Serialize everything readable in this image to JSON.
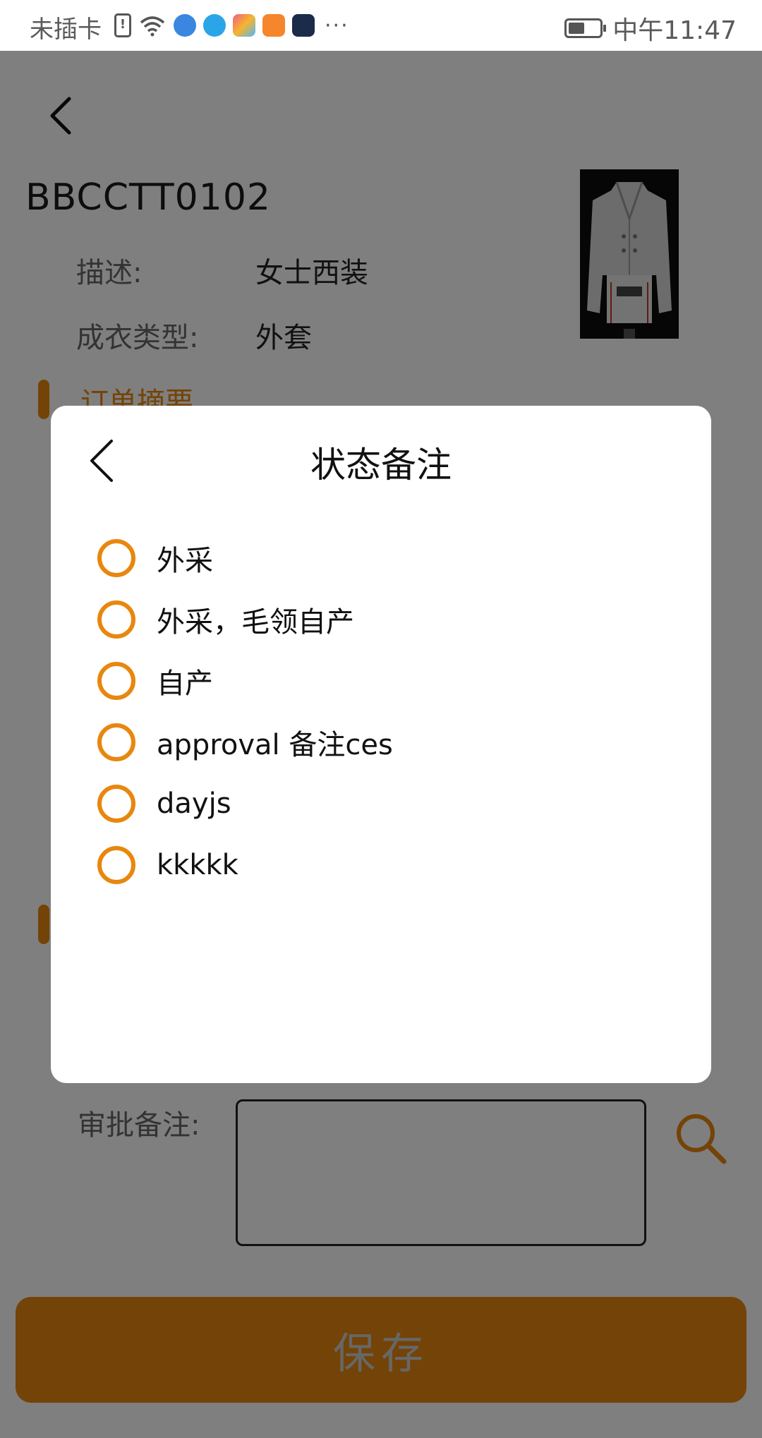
{
  "status_bar": {
    "carrier": "未插卡",
    "sim_icon": "!",
    "more": "···",
    "time": "中午11:47"
  },
  "page": {
    "order_code": "BBCCTT0102",
    "description_label": "描述:",
    "description_value": "女士西装",
    "garment_type_label": "成衣类型:",
    "garment_type_value": "外套",
    "section_title": "订单摘要",
    "approval_note_label": "审批备注:",
    "save_label": "保存"
  },
  "modal": {
    "title": "状态备注",
    "options": [
      {
        "label": "外采"
      },
      {
        "label": "外采，毛领自产"
      },
      {
        "label": "自产"
      },
      {
        "label": "approval 备注ces"
      },
      {
        "label": "dayjs"
      },
      {
        "label": "kkkkk"
      }
    ]
  },
  "colors": {
    "accent": "#e8870f",
    "overlay": "rgba(0,0,0,0.5)"
  },
  "icons": [
    "back-arrow-icon",
    "search-icon",
    "battery-icon",
    "wifi-icon"
  ]
}
